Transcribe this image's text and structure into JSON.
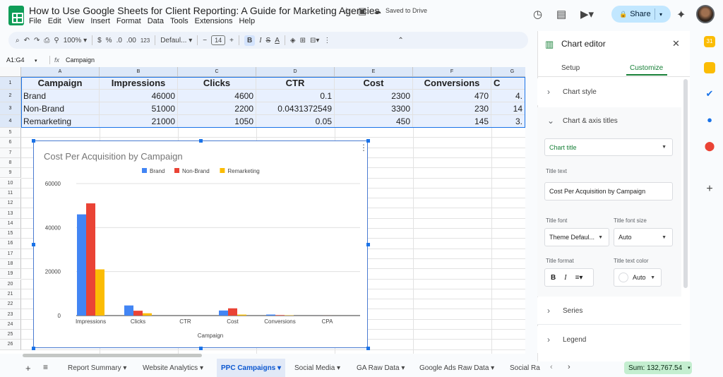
{
  "doc": {
    "title": "How to Use Google Sheets for Client Reporting: A Guide for Marketing Agencies",
    "saved_status": "Saved to Drive",
    "share_label": "Share"
  },
  "menu": [
    "File",
    "Edit",
    "View",
    "Insert",
    "Format",
    "Data",
    "Tools",
    "Extensions",
    "Help"
  ],
  "toolbar": {
    "zoom": "100%",
    "currency": "$",
    "percent": "%",
    "decimal_dec": ".0",
    "decimal_inc": ".00",
    "number_format": "123",
    "font": "Defaul...",
    "font_size": "14",
    "bold": "B",
    "italic": "I",
    "strike": "S",
    "text_color": "A"
  },
  "formula_bar": {
    "name_box": "A1:G4",
    "fx": "fx",
    "content": "Campaign"
  },
  "columns": [
    "A",
    "B",
    "C",
    "D",
    "E",
    "F",
    "G"
  ],
  "row_numbers": [
    "1",
    "2",
    "3",
    "4",
    "5",
    "6",
    "7",
    "8",
    "9",
    "10",
    "11",
    "12",
    "13",
    "14",
    "15",
    "16",
    "17",
    "18",
    "19",
    "20",
    "21",
    "22",
    "23",
    "24",
    "25",
    "26"
  ],
  "table": {
    "headers": [
      "Campaign",
      "Impressions",
      "Clicks",
      "CTR",
      "Cost",
      "Conversions",
      "C"
    ],
    "rows": [
      [
        "Brand",
        "46000",
        "4600",
        "0.1",
        "2300",
        "470",
        "4."
      ],
      [
        "Non-Brand",
        "51000",
        "2200",
        "0.0431372549",
        "3300",
        "230",
        "14"
      ],
      [
        "Remarketing",
        "21000",
        "1050",
        "0.05",
        "450",
        "145",
        "3."
      ]
    ]
  },
  "chart_data": {
    "type": "bar",
    "title": "Cost Per Acquisition by Campaign",
    "xlabel": "Campaign",
    "ylabel": "",
    "categories": [
      "Impressions",
      "Clicks",
      "CTR",
      "Cost",
      "Conversions",
      "CPA"
    ],
    "series": [
      {
        "name": "Brand",
        "color": "#4285f4",
        "values": [
          46000,
          4600,
          0.1,
          2300,
          470,
          4.9
        ]
      },
      {
        "name": "Non-Brand",
        "color": "#ea4335",
        "values": [
          51000,
          2200,
          0.04,
          3300,
          230,
          14.3
        ]
      },
      {
        "name": "Remarketing",
        "color": "#fbbc04",
        "values": [
          21000,
          1050,
          0.05,
          450,
          145,
          3.1
        ]
      }
    ],
    "yticks": [
      "0",
      "20000",
      "40000",
      "60000"
    ],
    "ylim": [
      0,
      60000
    ],
    "legend_position": "top",
    "grid": true
  },
  "sheet_tabs": [
    "Report Summary",
    "Website Analytics",
    "PPC Campaigns",
    "Social Media",
    "GA Raw Data",
    "Google Ads Raw Data",
    "Social Ra"
  ],
  "active_sheet": "PPC Campaigns",
  "sum_label": "Sum: 132,767.54",
  "editor": {
    "title": "Chart editor",
    "tabs": [
      "Setup",
      "Customize"
    ],
    "active_tab": "Customize",
    "sections": [
      "Chart style",
      "Chart & axis titles",
      "Series",
      "Legend"
    ],
    "title_type": "Chart title",
    "title_text_label": "Title text",
    "title_text_value": "Cost Per Acquisition by Campaign",
    "title_font_label": "Title font",
    "title_font_value": "Theme Defaul...",
    "title_size_label": "Title font size",
    "title_size_value": "Auto",
    "title_format_label": "Title format",
    "title_color_label": "Title text color",
    "title_color_value": "Auto"
  }
}
